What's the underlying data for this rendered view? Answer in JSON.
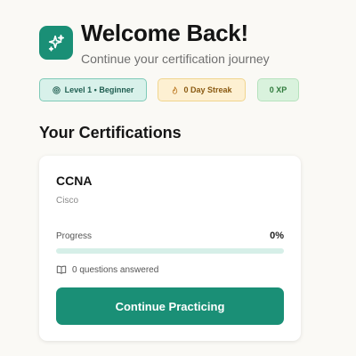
{
  "header": {
    "icon": "sparkles-icon",
    "title": "Welcome Back!",
    "subtitle": "Continue your certification journey"
  },
  "badges": {
    "level": {
      "icon": "target-icon",
      "label": "Level 1 • Beginner"
    },
    "streak": {
      "icon": "flame-icon",
      "label": "0 Day Streak"
    },
    "xp": {
      "label": "0 XP"
    }
  },
  "certifications": {
    "section_title": "Your Certifications",
    "items": [
      {
        "name": "CCNA",
        "vendor": "Cisco",
        "progress_label": "Progress",
        "progress_value": "0%",
        "progress_fraction": 0,
        "questions_icon": "book-open-icon",
        "questions_text": "0 questions answered",
        "cta_label": "Continue Practicing"
      }
    ]
  },
  "colors": {
    "accent": "#1a8f76",
    "background": "#faf9f5"
  }
}
